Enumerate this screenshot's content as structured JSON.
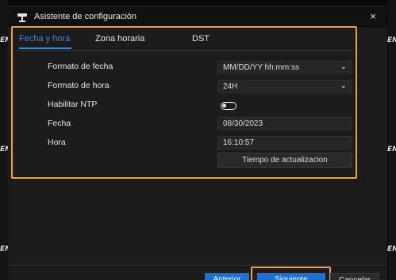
{
  "window": {
    "title": "Asistente de configuración",
    "close_glyph": "×"
  },
  "tabs": [
    {
      "label": "Fecha y hora",
      "active": true
    },
    {
      "label": "Zona horaria",
      "active": false
    },
    {
      "label": "DST",
      "active": false
    }
  ],
  "form": {
    "date_format": {
      "label": "Formato de fecha",
      "value": "MM/DD/YY hh:mm:ss"
    },
    "time_format": {
      "label": "Formato de hora",
      "value": "24H"
    },
    "ntp": {
      "label": "Habilitar NTP",
      "enabled": false
    },
    "date": {
      "label": "Fecha",
      "value": "08/30/2023"
    },
    "time": {
      "label": "Hora",
      "value": "16:10:57"
    },
    "update_button": "Tiempo de actualizacion"
  },
  "footer": {
    "prev_label": "Anterior",
    "next_label": "Siguiente",
    "cancel_label": "Cancelar"
  },
  "watermark": {
    "text": "EN"
  },
  "colors": {
    "accent": "#1f6fd0",
    "highlight": "#e8a24c",
    "tab_active": "#2e8ce6"
  },
  "icons": {
    "title": "camera-icon",
    "dropdown": "chevron-down-icon",
    "close": "close-icon"
  }
}
